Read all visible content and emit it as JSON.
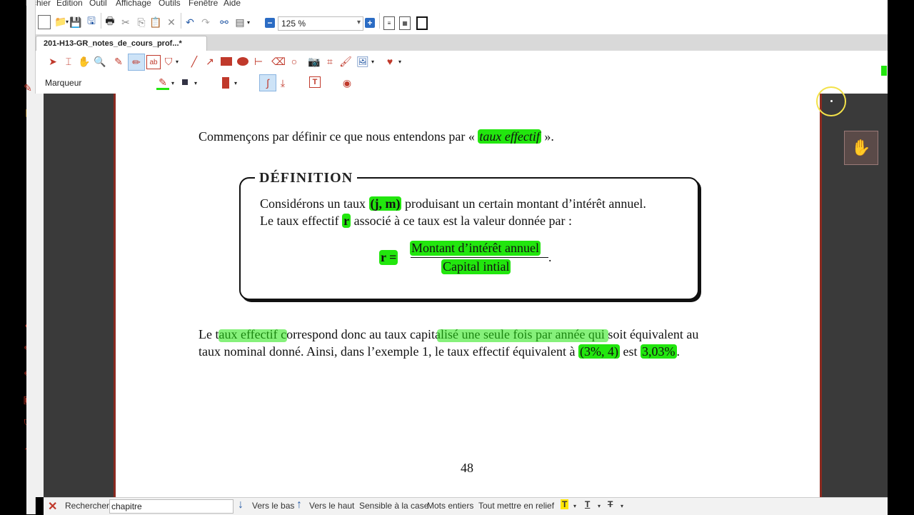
{
  "menu": [
    "Fichier",
    "Edition",
    "Outil",
    "Affichage",
    "Outils",
    "Fenêtre",
    "Aide"
  ],
  "toolbar": {
    "zoom_value": "125 %"
  },
  "tab": {
    "title": "201-H13-GR_notes_de_cours_prof...*"
  },
  "annotation_toolbar": {
    "tool_label": "Marqueur",
    "accent_color": "#22e60e"
  },
  "document": {
    "intro_prefix": "Commençons par définir ce que nous entendons par «",
    "intro_term": "taux effectif",
    "intro_suffix": "».",
    "definition": {
      "title": "DÉFINITION",
      "line1_a": "Considérons un taux",
      "line1_jm": "(j, m)",
      "line1_b": "produisant un certain montant d’intérêt annuel.",
      "line2_a": "Le taux effectif",
      "line2_r": "r",
      "line2_b": "associé à ce taux est la valeur donnée par :",
      "formula_lhs": "r =",
      "numerator": "Montant d’intérêt annuel",
      "denominator": "Capital intial",
      "formula_end": "."
    },
    "para_line1_a": "Le taux effectif correspond donc au taux capitalisé une seule fois par année qui soit équivalent au",
    "para_line2_a": "taux nominal donné. Ainsi, dans l’exemple 1, le taux effectif équivalent à",
    "para_line2_b": "(3%, 4)",
    "para_line2_c": "est",
    "para_line2_d": "3,03%",
    "para_line2_e": ".",
    "page_number": "48"
  },
  "findbar": {
    "label": "Rechercher:",
    "value": "chapitre",
    "down": "Vers le bas",
    "up": "Vers le haut",
    "case": "Sensible à la case",
    "whole": "Mots entiers",
    "highlight_all": "Tout mettre en relief"
  }
}
